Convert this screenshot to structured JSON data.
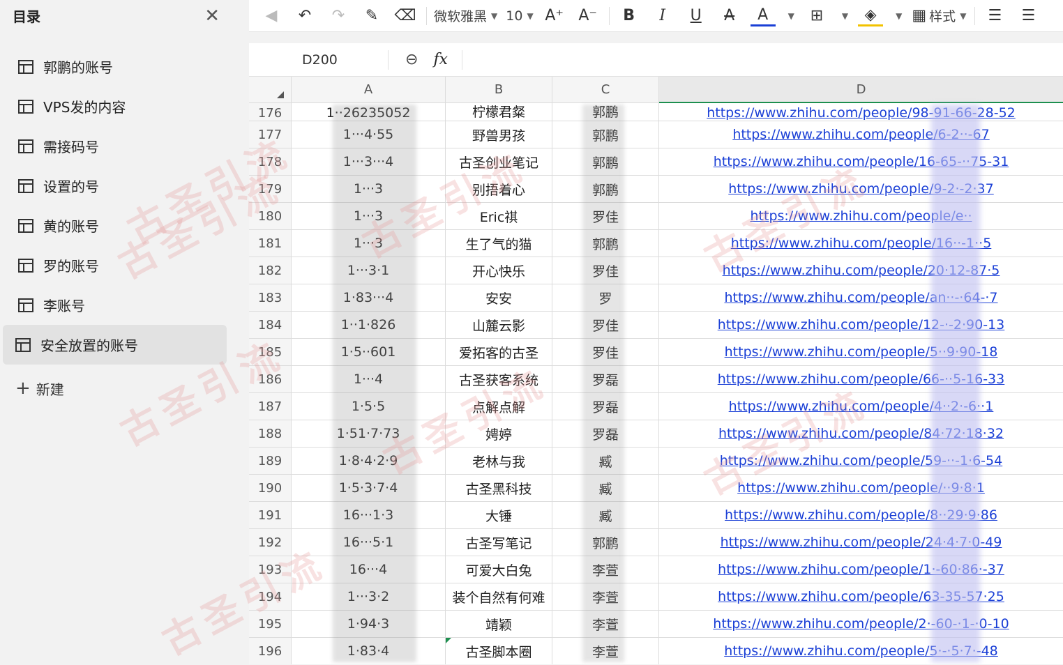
{
  "sidebar": {
    "title": "目录",
    "items": [
      {
        "label": "郭鹏的账号"
      },
      {
        "label": "VPS发的内容"
      },
      {
        "label": "需接码号"
      },
      {
        "label": "设置的号"
      },
      {
        "label": "黄的账号"
      },
      {
        "label": "罗的账号"
      },
      {
        "label": "李账号"
      },
      {
        "label": "安全放置的账号"
      }
    ],
    "new_label": "新建"
  },
  "toolbar": {
    "font_name": "微软雅黑",
    "font_size": "10",
    "style_label": "样式"
  },
  "formula_bar": {
    "cell_ref": "D200",
    "fx_label": "fx"
  },
  "grid": {
    "columns": [
      "A",
      "B",
      "C",
      "D"
    ],
    "rows": [
      {
        "num": "176",
        "a": "1··26235052",
        "b": "柠檬君粲",
        "c": "郭鹏",
        "d": "https://www.zhihu.com/people/98-91-66-28-52"
      },
      {
        "num": "177",
        "a": "1···4·55",
        "b": "野兽男孩",
        "c": "郭鹏",
        "d": "https://www.zhihu.com/people/6-2··-67"
      },
      {
        "num": "178",
        "a": "1···3···4",
        "b": "古圣创业笔记",
        "c": "郭鹏",
        "d": "https://www.zhihu.com/people/16-65-··75-31"
      },
      {
        "num": "179",
        "a": "1···3",
        "b": "别捂着心",
        "c": "郭鹏",
        "d": "https://www.zhihu.com/people/9-2·-2·37"
      },
      {
        "num": "180",
        "a": "1···3",
        "b": "Eric祺",
        "c": "罗佳",
        "d": "https://www.zhihu.com/people/e··"
      },
      {
        "num": "181",
        "a": "1···3",
        "b": "生了气的猫",
        "c": "郭鹏",
        "d": "https://www.zhihu.com/people/16··-1··5"
      },
      {
        "num": "182",
        "a": "1···3·1",
        "b": "开心快乐",
        "c": "罗佳",
        "d": "https://www.zhihu.com/people/20·12-87·5"
      },
      {
        "num": "183",
        "a": "1·83···4",
        "b": "安安",
        "c": "罗",
        "d": "https://www.zhihu.com/people/an··-·64-·7"
      },
      {
        "num": "184",
        "a": "1··1·826",
        "b": "山麓云影",
        "c": "罗佳",
        "d": "https://www.zhihu.com/people/12-·-2·90-13"
      },
      {
        "num": "185",
        "a": "1·5··601",
        "b": "爱拓客的古圣",
        "c": "罗佳",
        "d": "https://www.zhihu.com/people/5··9·90-18"
      },
      {
        "num": "186",
        "a": "1···4",
        "b": "古圣获客系统",
        "c": "罗磊",
        "d": "https://www.zhihu.com/people/66-··5-16-33"
      },
      {
        "num": "187",
        "a": "1·5·5",
        "b": "点解点解",
        "c": "罗磊",
        "d": "https://www.zhihu.com/people/4··2·-6··1"
      },
      {
        "num": "188",
        "a": "1·51·7·73",
        "b": "娉婷",
        "c": "罗磊",
        "d": "https://www.zhihu.com/people/84·72·18·32"
      },
      {
        "num": "189",
        "a": "1·8·4·2·9",
        "b": "老林与我",
        "c": "臧",
        "d": "https://www.zhihu.com/people/59-··-1·6-54"
      },
      {
        "num": "190",
        "a": "1·5·3·7·4",
        "b": "古圣黑科技",
        "c": "臧",
        "d": "https://www.zhihu.com/people/··9·8·1"
      },
      {
        "num": "191",
        "a": "16···1·3",
        "b": "大锤",
        "c": "臧",
        "d": "https://www.zhihu.com/people/8··29·9·86"
      },
      {
        "num": "192",
        "a": "16···5·1",
        "b": "古圣写笔记",
        "c": "郭鹏",
        "d": "https://www.zhihu.com/people/24·4·7·0-49"
      },
      {
        "num": "193",
        "a": "16···4",
        "b": "可爱大白兔",
        "c": "李萱",
        "d": "https://www.zhihu.com/people/1·-60·86·-37"
      },
      {
        "num": "194",
        "a": "1···3·2",
        "b": "装个自然有何难",
        "c": "李萱",
        "d": "https://www.zhihu.com/people/63-35-57·25"
      },
      {
        "num": "195",
        "a": "1·94·3",
        "b": "靖颖",
        "c": "李萱",
        "d": "https://www.zhihu.com/people/2·-60-·1-·0-10"
      },
      {
        "num": "196",
        "a": "1·83·4",
        "b": "古圣脚本圈",
        "c": "李萱",
        "d": "https://www.zhihu.com/people/5·-·5·7·-48"
      }
    ]
  },
  "watermark": "古圣引流",
  "colors": {
    "link": "#1a3fd6",
    "selection": "#1d8f4f",
    "sidebar_bg": "#f2f2f2"
  }
}
